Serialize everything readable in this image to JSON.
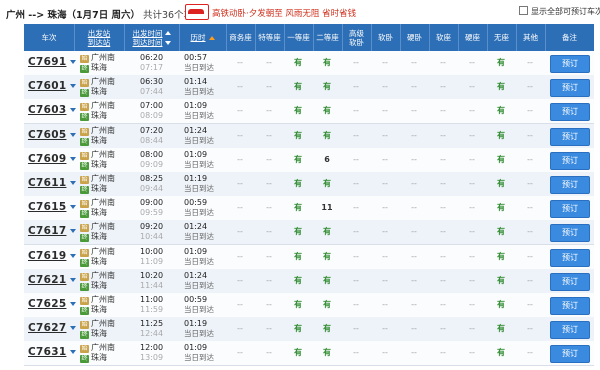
{
  "header": {
    "route": "广州 --> 珠海",
    "date": "（1月7日  周六）",
    "count": "共计36个车次",
    "banner_text": "高铁动卧·夕发朝至  风雨无阻  省时省钱",
    "show_all_label": "显示全部可预订车次"
  },
  "columns": {
    "train": "车次",
    "station_1": "出发站",
    "station_2": "到达站",
    "time_1": "出发时间",
    "time_2": "到达时间",
    "duration": "历时",
    "swz": "商务座",
    "tdz": "特等座",
    "ydz": "一等座",
    "edz": "二等座",
    "gjrw_1": "高级",
    "gjrw_2": "软卧",
    "rw": "软卧",
    "dw": "硬卧",
    "rz": "软座",
    "yz": "硬座",
    "wz": "无座",
    "qt": "其他",
    "note": "备注"
  },
  "book_label": "预订",
  "rows": [
    {
      "train": "C7691",
      "from": "广州南",
      "to": "珠海",
      "dep": "06:20",
      "arr": "07:17",
      "dur": "00:57",
      "day": "当日到达",
      "seats": [
        "--",
        "--",
        "有",
        "有",
        "--",
        "--",
        "--",
        "--",
        "--",
        "有",
        "--"
      ]
    },
    {
      "train": "C7601",
      "from": "广州南",
      "to": "珠海",
      "dep": "06:30",
      "arr": "07:44",
      "dur": "01:14",
      "day": "当日到达",
      "seats": [
        "--",
        "--",
        "有",
        "有",
        "--",
        "--",
        "--",
        "--",
        "--",
        "有",
        "--"
      ]
    },
    {
      "train": "C7603",
      "from": "广州南",
      "to": "珠海",
      "dep": "07:00",
      "arr": "08:09",
      "dur": "01:09",
      "day": "当日到达",
      "seats": [
        "--",
        "--",
        "有",
        "有",
        "--",
        "--",
        "--",
        "--",
        "--",
        "有",
        "--"
      ]
    },
    {
      "train": "C7605",
      "from": "广州南",
      "to": "珠海",
      "dep": "07:20",
      "arr": "08:44",
      "dur": "01:24",
      "day": "当日到达",
      "seats": [
        "--",
        "--",
        "有",
        "有",
        "--",
        "--",
        "--",
        "--",
        "--",
        "有",
        "--"
      ]
    },
    {
      "train": "C7609",
      "from": "广州南",
      "to": "珠海",
      "dep": "08:00",
      "arr": "09:09",
      "dur": "01:09",
      "day": "当日到达",
      "seats": [
        "--",
        "--",
        "有",
        "6",
        "--",
        "--",
        "--",
        "--",
        "--",
        "有",
        "--"
      ]
    },
    {
      "train": "C7611",
      "from": "广州南",
      "to": "珠海",
      "dep": "08:25",
      "arr": "09:44",
      "dur": "01:19",
      "day": "当日到达",
      "seats": [
        "--",
        "--",
        "有",
        "有",
        "--",
        "--",
        "--",
        "--",
        "--",
        "有",
        "--"
      ]
    },
    {
      "train": "C7615",
      "from": "广州南",
      "to": "珠海",
      "dep": "09:00",
      "arr": "09:59",
      "dur": "00:59",
      "day": "当日到达",
      "seats": [
        "--",
        "--",
        "有",
        "11",
        "--",
        "--",
        "--",
        "--",
        "--",
        "有",
        "--"
      ]
    },
    {
      "train": "C7617",
      "from": "广州南",
      "to": "珠海",
      "dep": "09:20",
      "arr": "10:44",
      "dur": "01:24",
      "day": "当日到达",
      "seats": [
        "--",
        "--",
        "有",
        "有",
        "--",
        "--",
        "--",
        "--",
        "--",
        "有",
        "--"
      ]
    },
    {
      "train": "C7619",
      "from": "广州南",
      "to": "珠海",
      "dep": "10:00",
      "arr": "11:09",
      "dur": "01:09",
      "day": "当日到达",
      "seats": [
        "--",
        "--",
        "有",
        "有",
        "--",
        "--",
        "--",
        "--",
        "--",
        "有",
        "--"
      ]
    },
    {
      "train": "C7621",
      "from": "广州南",
      "to": "珠海",
      "dep": "10:20",
      "arr": "11:44",
      "dur": "01:24",
      "day": "当日到达",
      "seats": [
        "--",
        "--",
        "有",
        "有",
        "--",
        "--",
        "--",
        "--",
        "--",
        "有",
        "--"
      ]
    },
    {
      "train": "C7625",
      "from": "广州南",
      "to": "珠海",
      "dep": "11:00",
      "arr": "11:59",
      "dur": "00:59",
      "day": "当日到达",
      "seats": [
        "--",
        "--",
        "有",
        "有",
        "--",
        "--",
        "--",
        "--",
        "--",
        "有",
        "--"
      ]
    },
    {
      "train": "C7627",
      "from": "广州南",
      "to": "珠海",
      "dep": "11:25",
      "arr": "12:44",
      "dur": "01:19",
      "day": "当日到达",
      "seats": [
        "--",
        "--",
        "有",
        "有",
        "--",
        "--",
        "--",
        "--",
        "--",
        "有",
        "--"
      ]
    },
    {
      "train": "C7631",
      "from": "广州南",
      "to": "珠海",
      "dep": "12:00",
      "arr": "13:09",
      "dur": "01:09",
      "day": "当日到达",
      "seats": [
        "--",
        "--",
        "有",
        "有",
        "--",
        "--",
        "--",
        "--",
        "--",
        "有",
        "--"
      ]
    }
  ]
}
